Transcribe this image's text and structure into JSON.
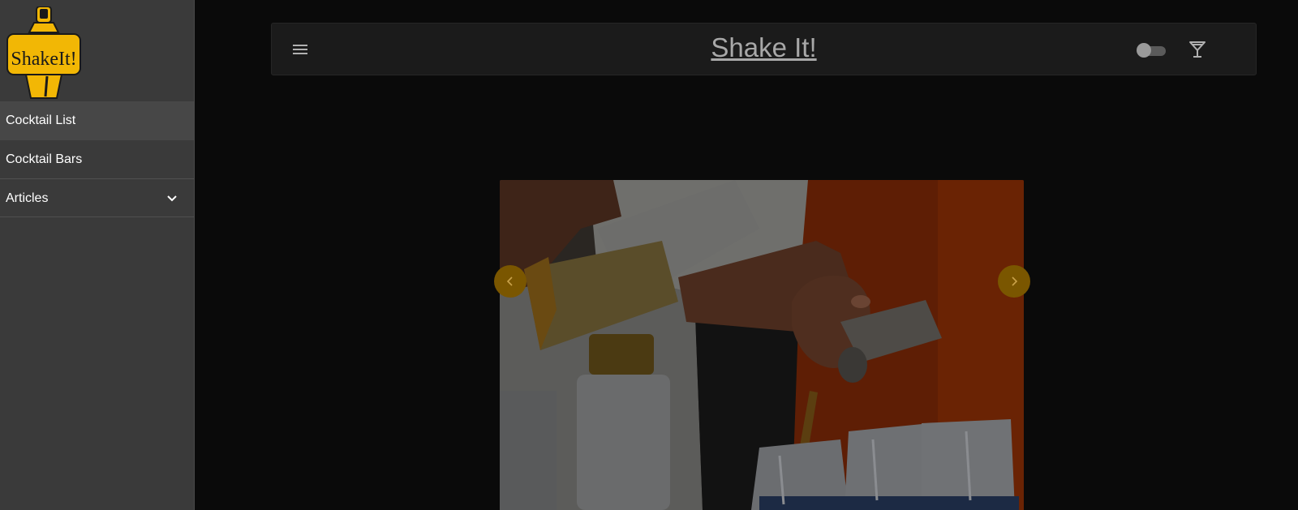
{
  "logo": {
    "text": "ShakeIt!"
  },
  "sidebar": {
    "items": [
      {
        "label": "Cocktail List",
        "active": true
      },
      {
        "label": "Cocktail Bars",
        "active": false
      },
      {
        "label": "Articles",
        "active": false,
        "icon": "chevron-down-icon"
      }
    ]
  },
  "header": {
    "title": "Shake It!",
    "menu_icon": "hamburger-menu-icon",
    "theme_toggle": {
      "on": false
    },
    "glass_icon": "cocktail-glass-icon"
  },
  "carousel": {
    "prev_icon": "chevron-left-icon",
    "next_icon": "chevron-right-icon"
  },
  "colors": {
    "accent": "#f2b705",
    "sidebar_bg": "#3a3a3a",
    "topbar_bg": "#1b1b1b",
    "page_bg": "#0a0a0a"
  }
}
